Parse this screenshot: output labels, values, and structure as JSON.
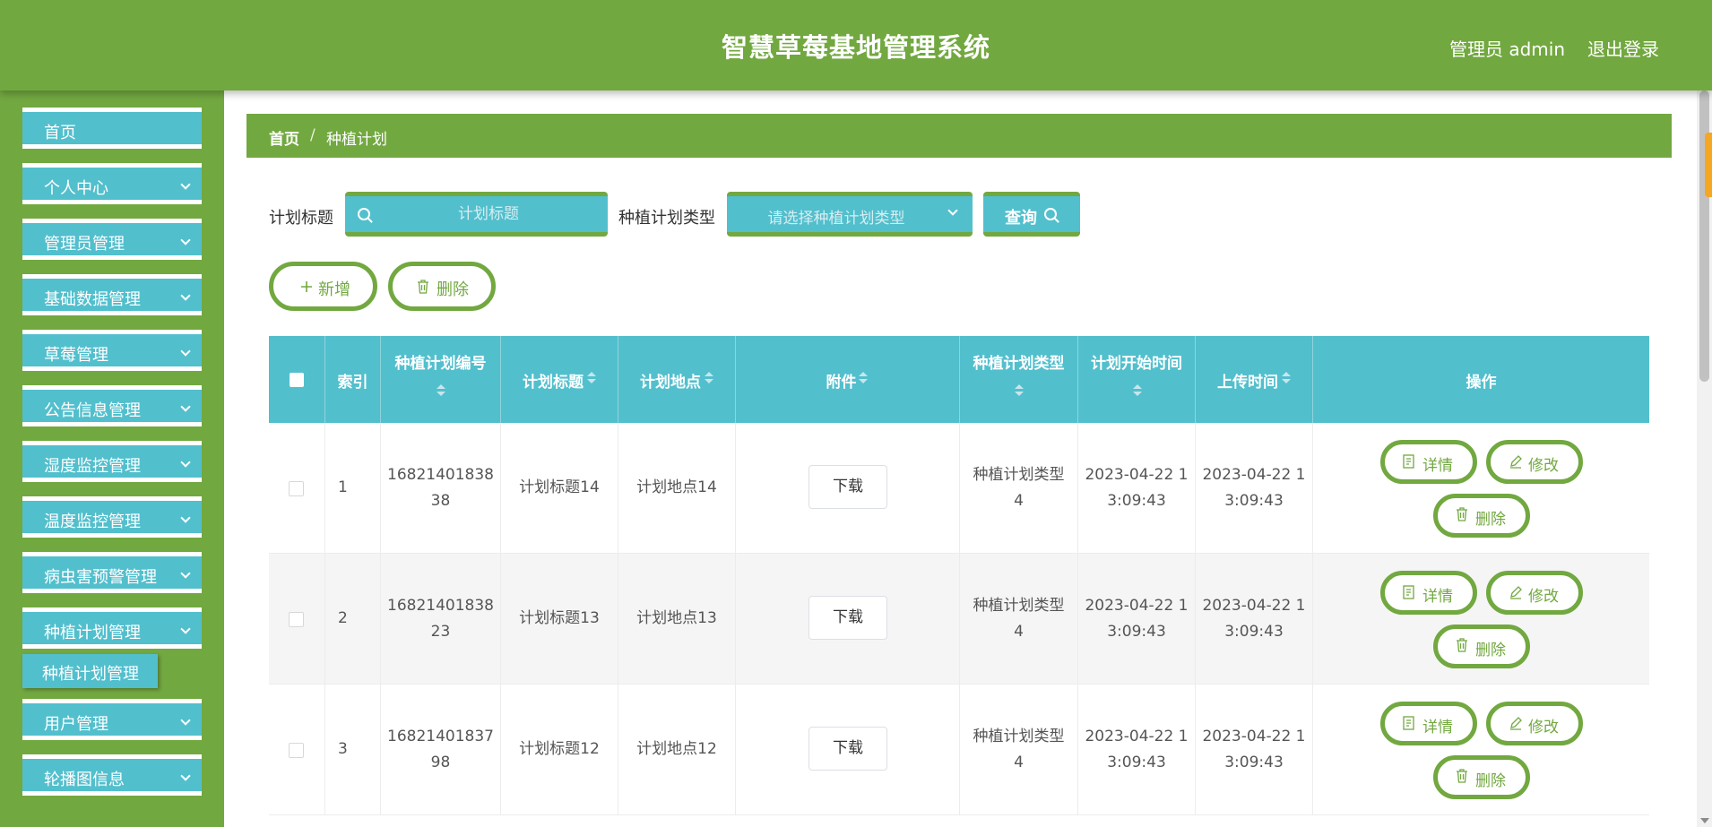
{
  "header": {
    "title": "智慧草莓基地管理系统",
    "admin_label": "管理员 admin",
    "logout_label": "退出登录"
  },
  "sidebar": {
    "items": [
      {
        "label": "首页",
        "has_arrow": false
      },
      {
        "label": "个人中心",
        "has_arrow": true
      },
      {
        "label": "管理员管理",
        "has_arrow": true
      },
      {
        "label": "基础数据管理",
        "has_arrow": true
      },
      {
        "label": "草莓管理",
        "has_arrow": true
      },
      {
        "label": "公告信息管理",
        "has_arrow": true
      },
      {
        "label": "湿度监控管理",
        "has_arrow": true
      },
      {
        "label": "温度监控管理",
        "has_arrow": true
      },
      {
        "label": "病虫害预警管理",
        "has_arrow": true
      },
      {
        "label": "种植计划管理",
        "has_arrow": true
      },
      {
        "label": "用户管理",
        "has_arrow": true
      },
      {
        "label": "轮播图信息",
        "has_arrow": true
      }
    ],
    "submenu_active": "种植计划管理"
  },
  "breadcrumb": {
    "home": "首页",
    "separator": "/",
    "current": "种植计划"
  },
  "search": {
    "title_label": "计划标题",
    "title_placeholder": "计划标题",
    "type_label": "种植计划类型",
    "type_placeholder": "请选择种植计划类型",
    "query_label": "查询"
  },
  "actions": {
    "add_label": "新增",
    "delete_label": "删除"
  },
  "table": {
    "columns": [
      "索引",
      "种植计划编号",
      "计划标题",
      "计划地点",
      "附件",
      "种植计划类型",
      "计划开始时间",
      "上传时间",
      "操作"
    ],
    "rows": [
      {
        "index": "1",
        "code_l1": "16821401838",
        "code_l2": "38",
        "title": "计划标题14",
        "place": "计划地点14",
        "attachment": "下载",
        "type_l1": "种植计划类型",
        "type_l2": "4",
        "start_l1": "2023-04-22 1",
        "start_l2": "3:09:43",
        "upload_l1": "2023-04-22 1",
        "upload_l2": "3:09:43"
      },
      {
        "index": "2",
        "code_l1": "16821401838",
        "code_l2": "23",
        "title": "计划标题13",
        "place": "计划地点13",
        "attachment": "下载",
        "type_l1": "种植计划类型",
        "type_l2": "4",
        "start_l1": "2023-04-22 1",
        "start_l2": "3:09:43",
        "upload_l1": "2023-04-22 1",
        "upload_l2": "3:09:43"
      },
      {
        "index": "3",
        "code_l1": "16821401837",
        "code_l2": "98",
        "title": "计划标题12",
        "place": "计划地点12",
        "attachment": "下载",
        "type_l1": "种植计划类型",
        "type_l2": "4",
        "start_l1": "2023-04-22 1",
        "start_l2": "3:09:43",
        "upload_l1": "2023-04-22 1",
        "upload_l2": "3:09:43"
      }
    ],
    "ops": {
      "detail": "详情",
      "edit": "修改",
      "delete": "删除"
    }
  },
  "colors": {
    "primary_green": "#72a840",
    "accent_teal": "#52bfcd",
    "highlight_orange": "#f5a623"
  }
}
